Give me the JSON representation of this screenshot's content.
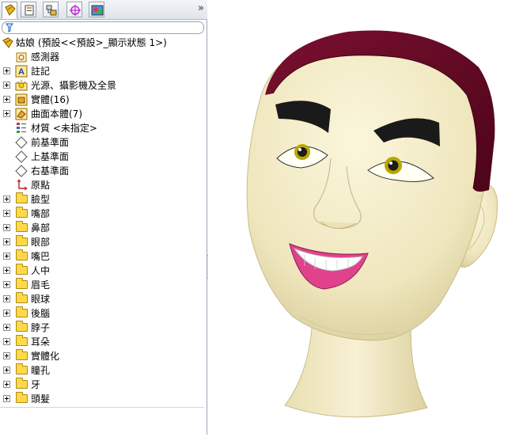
{
  "toolbar": {
    "tabs": [
      "feature-manager",
      "property-manager",
      "configuration-manager",
      "dimxpert-manager",
      "display-manager"
    ],
    "more_label": "»"
  },
  "tree": {
    "root": "姑娘  (預設<<預設>_顯示狀態 1>)",
    "items": [
      {
        "label": "感測器",
        "icon": "sensor-icon",
        "expandable": false
      },
      {
        "label": "註記",
        "icon": "annotation-icon",
        "expandable": true
      },
      {
        "label": "光源、攝影機及全景",
        "icon": "lights-camera-icon",
        "expandable": true
      },
      {
        "label": "實體(16)",
        "icon": "solid-bodies-icon",
        "expandable": true
      },
      {
        "label": "曲面本體(7)",
        "icon": "surface-bodies-icon",
        "expandable": true
      },
      {
        "label": "材質 <未指定>",
        "icon": "material-icon",
        "expandable": false
      },
      {
        "label": "前基準面",
        "icon": "plane-icon",
        "expandable": false
      },
      {
        "label": "上基準面",
        "icon": "plane-icon",
        "expandable": false
      },
      {
        "label": "右基準面",
        "icon": "plane-icon",
        "expandable": false
      },
      {
        "label": "原點",
        "icon": "origin-icon",
        "expandable": false
      },
      {
        "label": "臉型",
        "icon": "folder-icon",
        "expandable": true
      },
      {
        "label": "嘴部",
        "icon": "folder-icon",
        "expandable": true
      },
      {
        "label": "鼻部",
        "icon": "folder-icon",
        "expandable": true
      },
      {
        "label": "眼部",
        "icon": "folder-icon",
        "expandable": true
      },
      {
        "label": "嘴巴",
        "icon": "folder-icon",
        "expandable": true
      },
      {
        "label": "人中",
        "icon": "folder-icon",
        "expandable": true
      },
      {
        "label": "眉毛",
        "icon": "folder-icon",
        "expandable": true
      },
      {
        "label": "眼球",
        "icon": "folder-icon",
        "expandable": true
      },
      {
        "label": "後腦",
        "icon": "folder-icon",
        "expandable": true
      },
      {
        "label": "脖子",
        "icon": "folder-icon",
        "expandable": true
      },
      {
        "label": "耳朵",
        "icon": "folder-icon",
        "expandable": true
      },
      {
        "label": "實體化",
        "icon": "folder-icon",
        "expandable": true
      },
      {
        "label": "瞳孔",
        "icon": "folder-icon",
        "expandable": true
      },
      {
        "label": "牙",
        "icon": "folder-icon",
        "expandable": true
      },
      {
        "label": "頭髮",
        "icon": "folder-icon",
        "expandable": true
      }
    ]
  },
  "colors": {
    "skin": "#f4ecc8",
    "hair": "#6a0a22",
    "lips": "#e0428c",
    "brows": "#1a1a1a"
  }
}
